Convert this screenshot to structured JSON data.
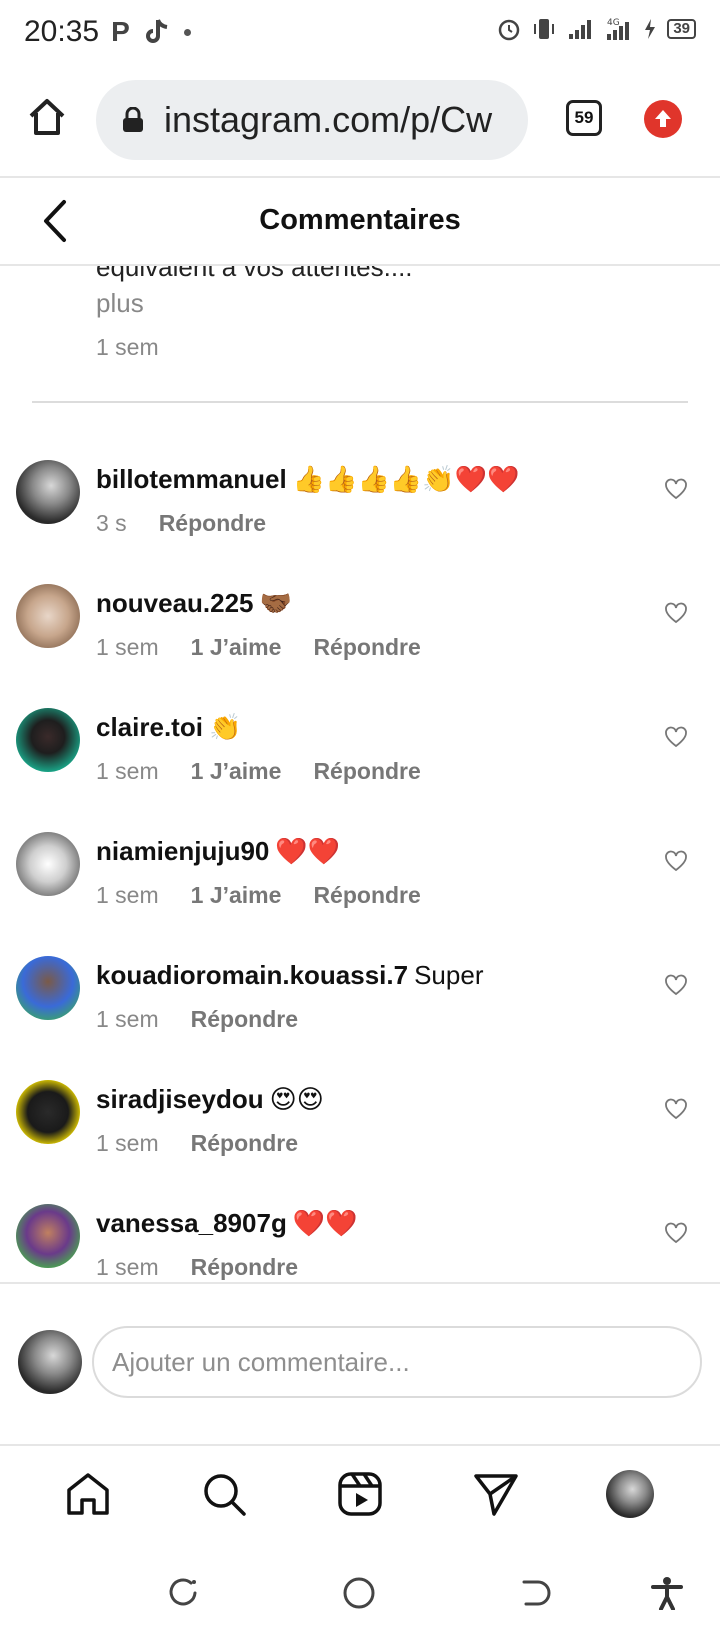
{
  "status_bar": {
    "time": "20:35",
    "left_icons": [
      "p-icon",
      "tiktok-icon",
      "dot-icon"
    ],
    "right_icons": [
      "alarm-icon",
      "vibrate-icon",
      "signal-icon",
      "4g-signal-icon",
      "charging-icon"
    ],
    "network": "4G",
    "battery": "39"
  },
  "browser": {
    "url": "instagram.com/p/Cw",
    "tab_count": "59",
    "accent_update": "#e0352b"
  },
  "header": {
    "title": "Commentaires"
  },
  "caption": {
    "text_fragment": "equivalent à vos attentes....",
    "more": "plus",
    "time": "1 sem"
  },
  "comments": [
    {
      "user": "billotemmanuel",
      "text": "👍👍👍👍👏❤️❤️",
      "time": "3 s",
      "likes": "",
      "reply": "Répondre"
    },
    {
      "user": "nouveau.225",
      "text": "🤝🏾",
      "time": "1 sem",
      "likes": "1 J’aime",
      "reply": "Répondre"
    },
    {
      "user": "claire.toi",
      "text": "👏",
      "time": "1 sem",
      "likes": "1 J’aime",
      "reply": "Répondre"
    },
    {
      "user": "niamienjuju90",
      "text": "❤️❤️",
      "time": "1 sem",
      "likes": "1 J’aime",
      "reply": "Répondre"
    },
    {
      "user": "kouadioromain.kouassi.7",
      "text": "Super",
      "time": "1 sem",
      "likes": "",
      "reply": "Répondre"
    },
    {
      "user": "siradjiseydou",
      "text": "😍😍",
      "time": "1 sem",
      "likes": "",
      "reply": "Répondre"
    },
    {
      "user": "vanessa_8907g",
      "text": "❤️❤️",
      "time": "1 sem",
      "likes": "",
      "reply": "Répondre"
    }
  ],
  "add_comment": {
    "placeholder": "Ajouter un commentaire..."
  },
  "bottom_nav": [
    "home-icon",
    "search-icon",
    "reels-icon",
    "direct-icon",
    "profile-avatar"
  ],
  "android_nav": [
    "recents-icon",
    "home-circle-icon",
    "back-icon",
    "accessibility-icon"
  ]
}
